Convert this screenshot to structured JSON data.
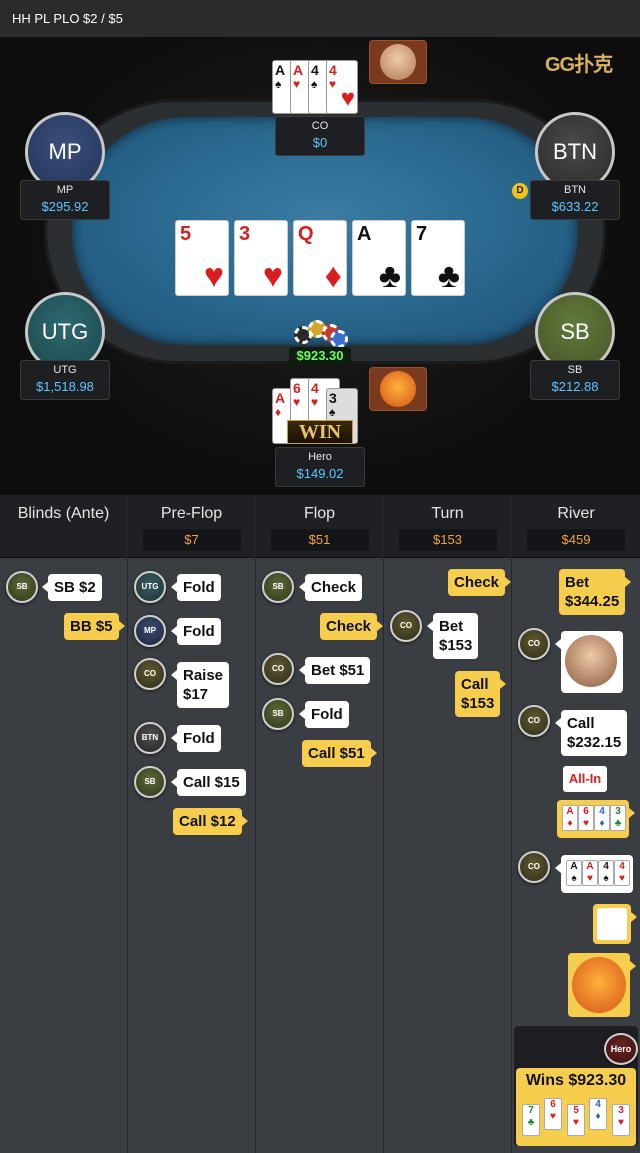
{
  "header": {
    "title": "HH PL PLO $2 / $5"
  },
  "logo": "GG扑克",
  "players": {
    "co": {
      "name": "CO",
      "stack": "$0"
    },
    "mp": {
      "name": "MP",
      "seat": "MP",
      "stack": "$295.92"
    },
    "btn": {
      "name": "BTN",
      "seat": "BTN",
      "stack": "$633.22"
    },
    "utg": {
      "name": "UTG",
      "seat": "UTG",
      "stack": "$1,518.98"
    },
    "sb": {
      "name": "SB",
      "seat": "SB",
      "stack": "$212.88"
    },
    "hero": {
      "name": "Hero",
      "stack": "$149.02"
    }
  },
  "dealer_button": "D",
  "board": [
    {
      "rank": "5",
      "suit": "♥",
      "color": "red"
    },
    {
      "rank": "3",
      "suit": "♥",
      "color": "red"
    },
    {
      "rank": "Q",
      "suit": "♦",
      "color": "red"
    },
    {
      "rank": "A",
      "suit": "♣",
      "color": "black"
    },
    {
      "rank": "7",
      "suit": "♣",
      "color": "black"
    }
  ],
  "co_hand": [
    {
      "rank": "A",
      "suit": "♠"
    },
    {
      "rank": "A",
      "suit": "♥"
    },
    {
      "rank": "4",
      "suit": "♠"
    },
    {
      "rank": "4",
      "suit": "♥"
    }
  ],
  "hero_hand": [
    {
      "rank": "A",
      "suit": "♦"
    },
    {
      "rank": "6",
      "suit": "♥"
    },
    {
      "rank": "4",
      "suit": "♥"
    },
    {
      "rank": "3",
      "suit": "♠"
    }
  ],
  "pot": "$923.30",
  "win_badge": "WIN",
  "streets": [
    {
      "name": "Blinds (Ante)",
      "pot": ""
    },
    {
      "name": "Pre-Flop",
      "pot": "$7"
    },
    {
      "name": "Flop",
      "pot": "$51"
    },
    {
      "name": "Turn",
      "pot": "$153"
    },
    {
      "name": "River",
      "pot": "$459"
    }
  ],
  "actions": {
    "blinds": [
      {
        "pos": "SB",
        "text": "SB  $2"
      },
      {
        "pos": "Hero",
        "text": "BB  $5"
      }
    ],
    "preflop": [
      {
        "pos": "UTG",
        "text": "Fold"
      },
      {
        "pos": "MP",
        "text": "Fold"
      },
      {
        "pos": "CO",
        "text": "Raise\n$17"
      },
      {
        "pos": "BTN",
        "text": "Fold"
      },
      {
        "pos": "SB",
        "text": "Call  $15"
      },
      {
        "pos": "Hero",
        "text": "Call  $12"
      }
    ],
    "flop": [
      {
        "pos": "SB",
        "text": "Check"
      },
      {
        "pos": "Hero",
        "text": "Check"
      },
      {
        "pos": "CO",
        "text": "Bet  $51"
      },
      {
        "pos": "SB",
        "text": "Fold"
      },
      {
        "pos": "Hero",
        "text": "Call  $51"
      }
    ],
    "turn": [
      {
        "pos": "Hero",
        "text": "Check"
      },
      {
        "pos": "CO",
        "text": "Bet\n$153"
      },
      {
        "pos": "Hero",
        "text": "Call\n$153"
      }
    ],
    "river": [
      {
        "pos": "Hero",
        "text": "Bet\n$344.25"
      },
      {
        "pos": "CO",
        "text": ""
      },
      {
        "pos": "CO",
        "text": "Call\n$232.15"
      },
      {
        "pos": "CO",
        "text": "All-In"
      }
    ]
  },
  "chip_labels": {
    "sb": "SB",
    "utg": "UTG",
    "mp": "MP",
    "co": "CO",
    "btn": "BTN",
    "hero": "Hero"
  },
  "result": {
    "text": "Wins $923.30"
  },
  "hero_showdown": [
    {
      "rank": "7",
      "suit": "♣"
    },
    {
      "rank": "6",
      "suit": "♥"
    },
    {
      "rank": "5",
      "suit": "♥"
    },
    {
      "rank": "4",
      "suit": "♦"
    },
    {
      "rank": "3",
      "suit": "♥"
    }
  ],
  "hero_shown_hand": [
    {
      "rank": "A",
      "suit": "♦"
    },
    {
      "rank": "6",
      "suit": "♥"
    },
    {
      "rank": "4",
      "suit": "♦"
    },
    {
      "rank": "3",
      "suit": "♣"
    }
  ],
  "co_shown_hand": [
    {
      "rank": "A",
      "suit": "♠"
    },
    {
      "rank": "A",
      "suit": "♥"
    },
    {
      "rank": "4",
      "suit": "♠"
    },
    {
      "rank": "4",
      "suit": "♥"
    }
  ]
}
